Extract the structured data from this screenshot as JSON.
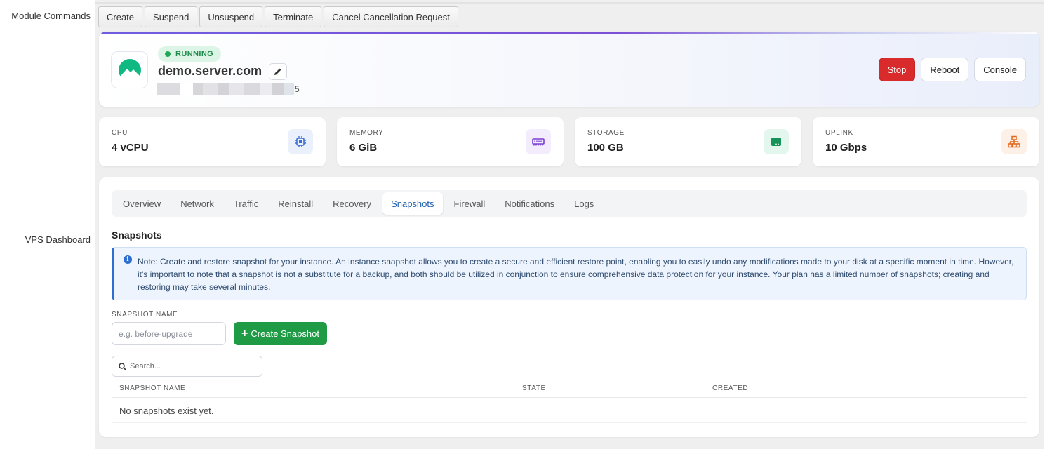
{
  "labels": {
    "module_commands": "Module Commands",
    "vps_dashboard": "VPS Dashboard"
  },
  "commands": [
    "Create",
    "Suspend",
    "Unsuspend",
    "Terminate",
    "Cancel Cancellation Request"
  ],
  "server": {
    "status": "RUNNING",
    "hostname": "demo.server.com",
    "ip_tail": "5"
  },
  "actions": {
    "stop": "Stop",
    "reboot": "Reboot",
    "console": "Console"
  },
  "stats": [
    {
      "label": "CPU",
      "value": "4 vCPU",
      "icon": "cpu-icon",
      "color": "#3b6fd4",
      "bg": "#eaf1fd"
    },
    {
      "label": "MEMORY",
      "value": "6 GiB",
      "icon": "memory-icon",
      "color": "#7a3fd0",
      "bg": "#f2ecfd"
    },
    {
      "label": "STORAGE",
      "value": "100 GB",
      "icon": "storage-icon",
      "color": "#17935a",
      "bg": "#e4f7ee"
    },
    {
      "label": "UPLINK",
      "value": "10 Gbps",
      "icon": "network-icon",
      "color": "#e2671f",
      "bg": "#fdf0e6"
    }
  ],
  "tabs": [
    "Overview",
    "Network",
    "Traffic",
    "Reinstall",
    "Recovery",
    "Snapshots",
    "Firewall",
    "Notifications",
    "Logs"
  ],
  "active_tab": "Snapshots",
  "snapshots": {
    "title": "Snapshots",
    "note": "Note: Create and restore snapshot for your instance. An instance snapshot allows you to create a secure and efficient restore point, enabling you to easily undo any modifications made to your disk at a specific moment in time. However, it's important to note that a snapshot is not a substitute for a backup, and both should be utilized in conjunction to ensure comprehensive data protection for your instance. Your plan has a limited number of snapshots; creating and restoring may take several minutes.",
    "field_label": "SNAPSHOT NAME",
    "input_placeholder": "e.g. before-upgrade",
    "create_label": "Create Snapshot",
    "search_placeholder": "Search...",
    "columns": [
      "SNAPSHOT NAME",
      "STATE",
      "CREATED"
    ],
    "empty_text": "No snapshots exist yet."
  },
  "colors": {
    "accent": "#1d5fae",
    "stop": "#d92b2b",
    "create": "#1f9a45",
    "running": "#1f8a4c"
  }
}
